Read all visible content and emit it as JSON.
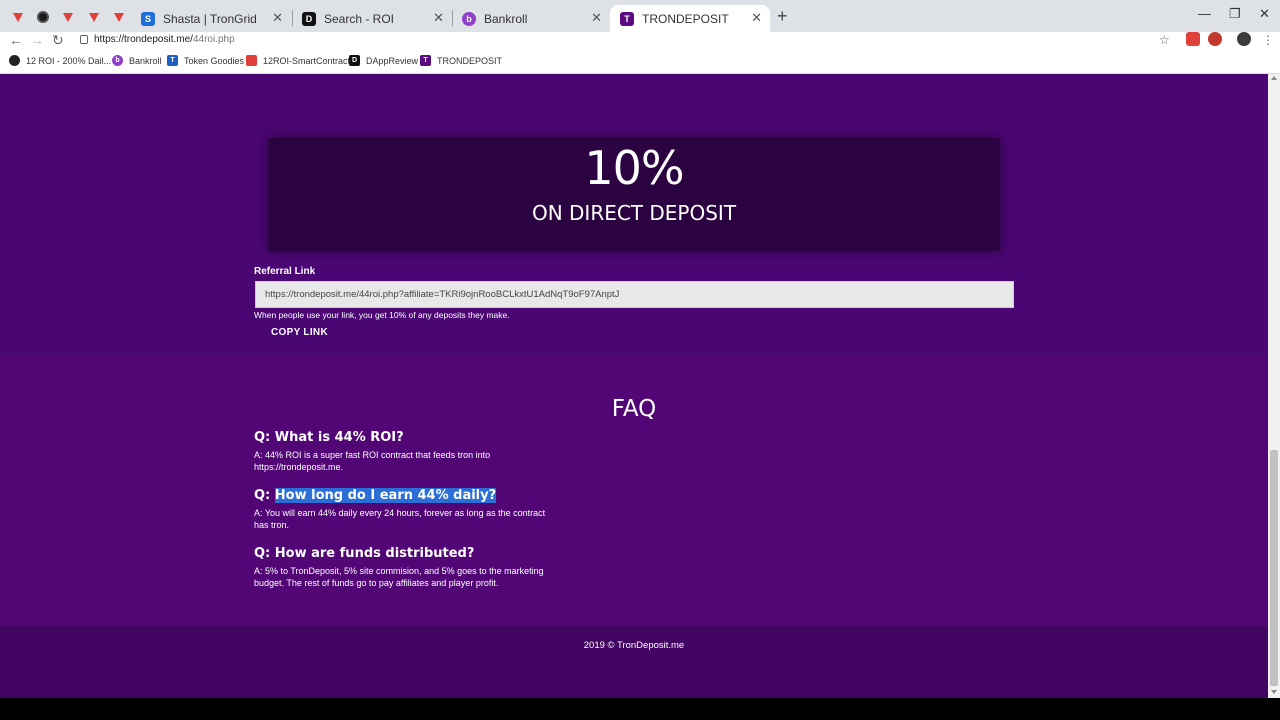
{
  "browser": {
    "tabs": [
      {
        "title": "Shasta | TronGrid"
      },
      {
        "title": "Search - ROI"
      },
      {
        "title": "Bankroll"
      },
      {
        "title": "TRONDEPOSIT"
      }
    ],
    "url_host": "https://trondeposit.me/",
    "url_path": "44roi.php",
    "bookmarks": [
      {
        "label": "12 ROI - 200% Dail..."
      },
      {
        "label": "Bankroll"
      },
      {
        "label": "Token Goodies"
      },
      {
        "label": "12ROI-SmartContract"
      },
      {
        "label": "DAppReview"
      },
      {
        "label": "TRONDEPOSIT"
      }
    ]
  },
  "promo": {
    "percent": "10%",
    "subtitle": "ON DIRECT DEPOSIT"
  },
  "referral": {
    "label": "Referral Link",
    "link": "https://trondeposit.me/44roi.php?affiliate=TKRi9ojnRooBCLkxtU1AdNqT9oF97AnptJ",
    "help": "When people use your link, you get 10% of any deposits they make.",
    "copy_label": "COPY LINK"
  },
  "faq": {
    "title": "FAQ",
    "items": [
      {
        "q_prefix": "Q: ",
        "q_text": "What is 44% ROI?",
        "a1": "A: 44% ROI is a super fast ROI contract that feeds tron into",
        "a2": "https://trondeposit.me."
      },
      {
        "q_prefix": "Q: ",
        "q_text": "How long do I earn 44% daily?",
        "a1": "A: You will earn 44% daily every 24 hours, forever as long as the contract",
        "a2": "has tron."
      },
      {
        "q_prefix": "Q: ",
        "q_text": "How are funds distributed?",
        "a1": "A: 5% to TronDeposit, 5% site commision, and 5% goes to the marketing",
        "a2": "budget. The rest of funds go to pay affiliates and player profit."
      }
    ]
  },
  "footer": {
    "text": "2019 © TronDeposit.me"
  },
  "colors": {
    "page_top": "#4a0672",
    "faq_bg": "#520676",
    "footer_bg": "#420561",
    "promo_box": "#2b0340",
    "highlight": "#2b6fd6"
  }
}
